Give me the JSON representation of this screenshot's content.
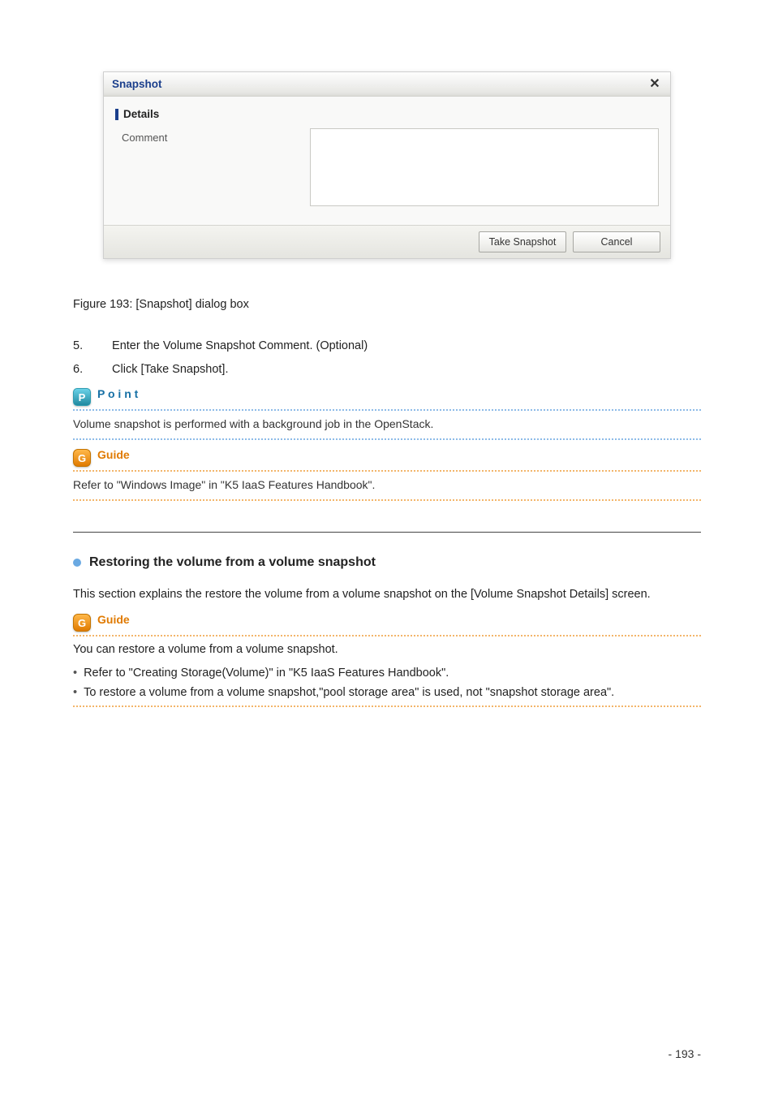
{
  "figure_caption": "Figure 193: [Snapshot] dialog box",
  "dialog": {
    "title": "Snapshot",
    "section_heading": "Details",
    "comment_label": "Comment",
    "comment_value": "",
    "primary_btn": "Take Snapshot",
    "cancel_btn": "Cancel"
  },
  "steps": {
    "s5": {
      "num": "5.",
      "text": "Enter the Volume Snapshot Comment. (Optional)"
    },
    "s6": {
      "num": "6.",
      "text": "Click [Take Snapshot]."
    }
  },
  "point": {
    "tag": "P o i n t",
    "text": "Volume snapshot is performed with a background job in the OpenStack."
  },
  "guide1": {
    "tag": "Guide",
    "text": "Refer to \"Windows Image\" in \"K5 IaaS Features Handbook\"."
  },
  "subsection": {
    "title": "Restoring the volume from a volume snapshot",
    "intro": "This section explains the restore the volume from a volume snapshot on the [Volume Snapshot Details] screen."
  },
  "guide2": {
    "tag": "Guide",
    "text_items": [
      "Refer to \"Creating Storage(Volume)\" in \"K5 IaaS Features Handbook\"."
    ]
  },
  "outro": {
    "lead": "You can restore a volume from a volume snapshot.",
    "bullets": [
      "To restore a volume from a volume snapshot,\"pool storage area\" is used, not \"snapshot storage area\"."
    ]
  },
  "page_number": "- 193 -"
}
